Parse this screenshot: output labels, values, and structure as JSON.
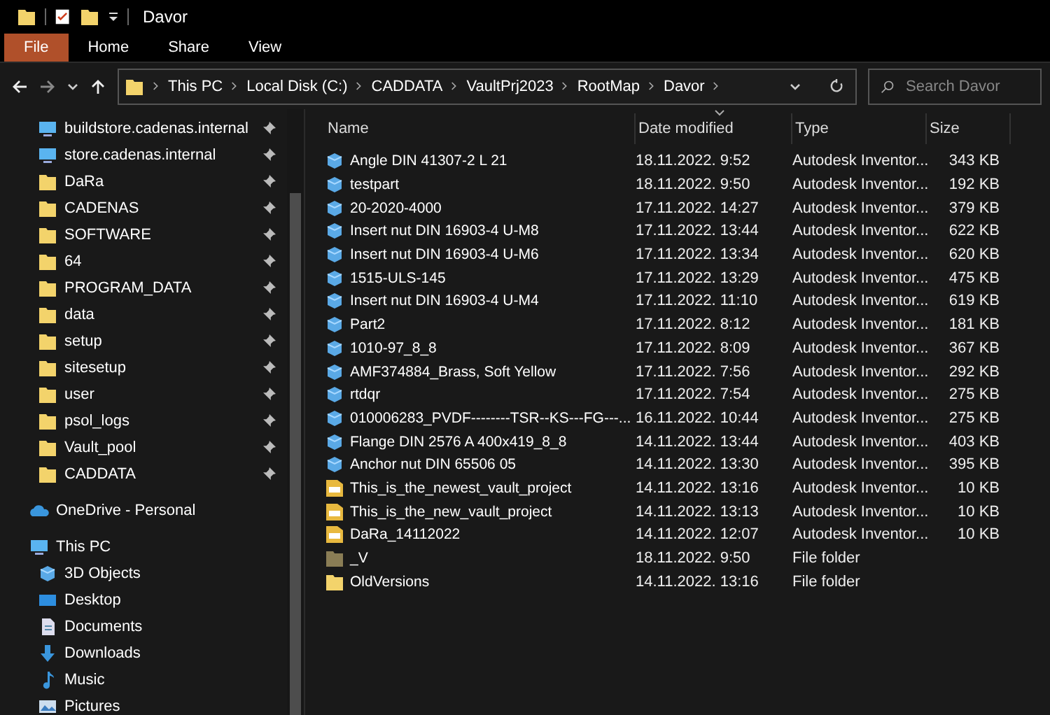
{
  "window": {
    "title": "Davor"
  },
  "ribbon_tabs": [
    {
      "label": "File",
      "selected": true
    },
    {
      "label": "Home",
      "selected": false
    },
    {
      "label": "Share",
      "selected": false
    },
    {
      "label": "View",
      "selected": false
    }
  ],
  "breadcrumb": [
    "This PC",
    "Local Disk (C:)",
    "CADDATA",
    "VaultPrj2023",
    "RootMap",
    "Davor"
  ],
  "search": {
    "placeholder": "Search Davor"
  },
  "sidebar": {
    "items": [
      {
        "label": "buildstore.cadenas.internal",
        "kind": "network",
        "pinned": true
      },
      {
        "label": "store.cadenas.internal",
        "kind": "network",
        "pinned": true
      },
      {
        "label": "DaRa",
        "kind": "folder",
        "pinned": true
      },
      {
        "label": "CADENAS",
        "kind": "folder",
        "pinned": true
      },
      {
        "label": "SOFTWARE",
        "kind": "folder",
        "pinned": true
      },
      {
        "label": "64",
        "kind": "folder",
        "pinned": true
      },
      {
        "label": "PROGRAM_DATA",
        "kind": "folder",
        "pinned": true
      },
      {
        "label": "data",
        "kind": "folder",
        "pinned": true
      },
      {
        "label": "setup",
        "kind": "folder",
        "pinned": true
      },
      {
        "label": "sitesetup",
        "kind": "folder",
        "pinned": true
      },
      {
        "label": "user",
        "kind": "folder",
        "pinned": true
      },
      {
        "label": "psol_logs",
        "kind": "folder",
        "pinned": true
      },
      {
        "label": "Vault_pool",
        "kind": "folder",
        "pinned": true
      },
      {
        "label": "CADDATA",
        "kind": "folder",
        "pinned": true
      },
      {
        "label": "OneDrive - Personal",
        "kind": "onedrive",
        "pinned": false,
        "top": true
      },
      {
        "label": "This PC",
        "kind": "pc",
        "pinned": false,
        "top": true
      },
      {
        "label": "3D Objects",
        "kind": "cube",
        "pinned": false
      },
      {
        "label": "Desktop",
        "kind": "desktop",
        "pinned": false
      },
      {
        "label": "Documents",
        "kind": "documents",
        "pinned": false
      },
      {
        "label": "Downloads",
        "kind": "downloads",
        "pinned": false
      },
      {
        "label": "Music",
        "kind": "music",
        "pinned": false
      },
      {
        "label": "Pictures",
        "kind": "pictures",
        "pinned": false
      }
    ]
  },
  "table": {
    "columns": [
      {
        "label": "Name",
        "sorted": false
      },
      {
        "label": "Date modified",
        "sorted": true
      },
      {
        "label": "Type",
        "sorted": false
      },
      {
        "label": "Size",
        "sorted": false
      }
    ],
    "rows": [
      {
        "kind": "part",
        "name": "Angle DIN 41307-2 L 21",
        "date": "18.11.2022. 9:52",
        "type": "Autodesk Inventor...",
        "size": "343 KB"
      },
      {
        "kind": "part",
        "name": "testpart",
        "date": "18.11.2022. 9:50",
        "type": "Autodesk Inventor...",
        "size": "192 KB"
      },
      {
        "kind": "part",
        "name": "20-2020-4000",
        "date": "17.11.2022. 14:27",
        "type": "Autodesk Inventor...",
        "size": "379 KB"
      },
      {
        "kind": "part",
        "name": "Insert nut DIN 16903-4 U-M8",
        "date": "17.11.2022. 13:44",
        "type": "Autodesk Inventor...",
        "size": "622 KB"
      },
      {
        "kind": "part",
        "name": "Insert nut DIN 16903-4 U-M6",
        "date": "17.11.2022. 13:34",
        "type": "Autodesk Inventor...",
        "size": "620 KB"
      },
      {
        "kind": "part",
        "name": "1515-ULS-145",
        "date": "17.11.2022. 13:29",
        "type": "Autodesk Inventor...",
        "size": "475 KB"
      },
      {
        "kind": "part",
        "name": "Insert nut DIN 16903-4 U-M4",
        "date": "17.11.2022. 11:10",
        "type": "Autodesk Inventor...",
        "size": "619 KB"
      },
      {
        "kind": "part",
        "name": "Part2",
        "date": "17.11.2022. 8:12",
        "type": "Autodesk Inventor...",
        "size": "181 KB"
      },
      {
        "kind": "part",
        "name": "1010-97_8_8",
        "date": "17.11.2022. 8:09",
        "type": "Autodesk Inventor...",
        "size": "367 KB"
      },
      {
        "kind": "part",
        "name": "AMF374884_Brass, Soft Yellow",
        "date": "17.11.2022. 7:56",
        "type": "Autodesk Inventor...",
        "size": "292 KB"
      },
      {
        "kind": "part",
        "name": "rtdqr",
        "date": "17.11.2022. 7:54",
        "type": "Autodesk Inventor...",
        "size": "275 KB"
      },
      {
        "kind": "part",
        "name": "010006283_PVDF--------TSR--KS---FG---...",
        "date": "16.11.2022. 10:44",
        "type": "Autodesk Inventor...",
        "size": "275 KB"
      },
      {
        "kind": "part",
        "name": "Flange DIN 2576 A 400x419_8_8",
        "date": "14.11.2022. 13:44",
        "type": "Autodesk Inventor...",
        "size": "403 KB"
      },
      {
        "kind": "part",
        "name": "Anchor nut DIN 65506 05",
        "date": "14.11.2022. 13:30",
        "type": "Autodesk Inventor...",
        "size": "395 KB"
      },
      {
        "kind": "project",
        "name": "This_is_the_newest_vault_project",
        "date": "14.11.2022. 13:16",
        "type": "Autodesk Inventor...",
        "size": "10 KB"
      },
      {
        "kind": "project",
        "name": "This_is_the_new_vault_project",
        "date": "14.11.2022. 13:13",
        "type": "Autodesk Inventor...",
        "size": "10 KB"
      },
      {
        "kind": "project",
        "name": "DaRa_14112022",
        "date": "14.11.2022. 12:07",
        "type": "Autodesk Inventor...",
        "size": "10 KB"
      },
      {
        "kind": "hidden-folder",
        "name": "_V",
        "date": "18.11.2022. 9:50",
        "type": "File folder"
      },
      {
        "kind": "folder",
        "name": "OldVersions",
        "date": "14.11.2022. 13:16",
        "type": "File folder"
      }
    ]
  }
}
